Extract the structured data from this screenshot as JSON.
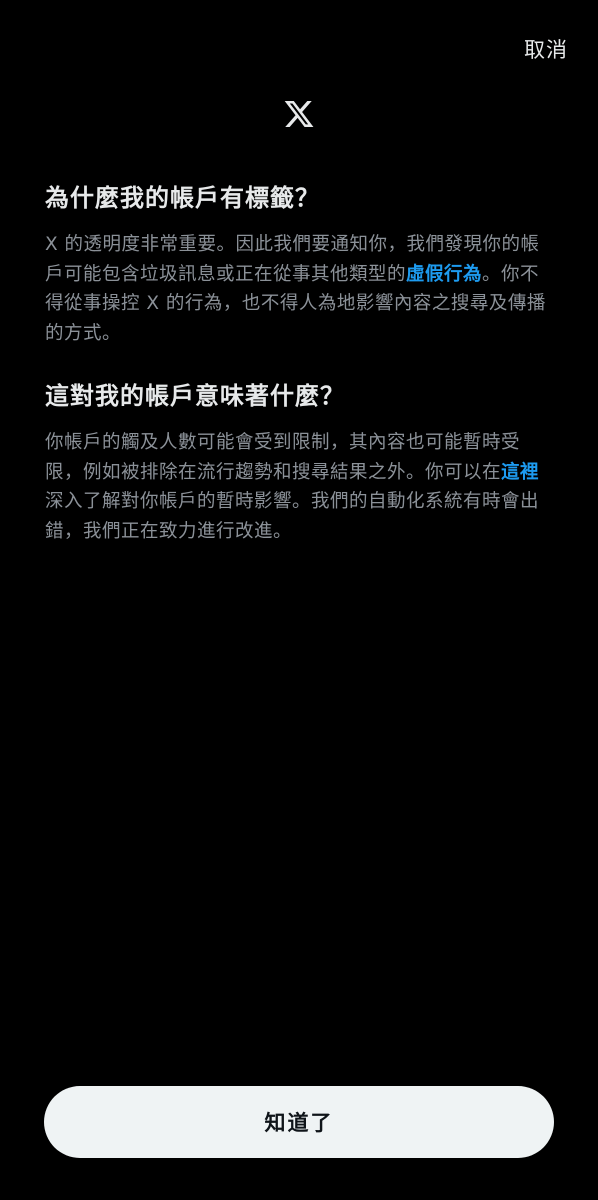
{
  "header": {
    "cancel_label": "取消",
    "logo_icon": "x-logo-icon"
  },
  "sections": [
    {
      "heading": "為什麼我的帳戶有標籤？",
      "body_before": "X 的透明度非常重要。因此我們要通知你，我們發現你的帳戶可能包含垃圾訊息或正在從事其他類型的",
      "link_text": "虛假行為",
      "body_after": "。你不得從事操控 X 的行為，也不得人為地影響內容之搜尋及傳播的方式。"
    },
    {
      "heading": "這對我的帳戶意味著什麼？",
      "body_before": "你帳戶的觸及人數可能會受到限制，其內容也可能暫時受限，例如被排除在流行趨勢和搜尋結果之外。你可以在",
      "link_text": "這裡",
      "body_after": "深入了解對你帳戶的暫時影響。我們的自動化系統有時會出錯，我們正在致力進行改進。"
    }
  ],
  "footer": {
    "confirm_label": "知道了"
  },
  "colors": {
    "background": "#000000",
    "heading": "#e7e9ea",
    "body": "#8b9198",
    "link": "#1d9bf0",
    "button_bg": "#eff3f4",
    "button_text": "#0f1419"
  }
}
